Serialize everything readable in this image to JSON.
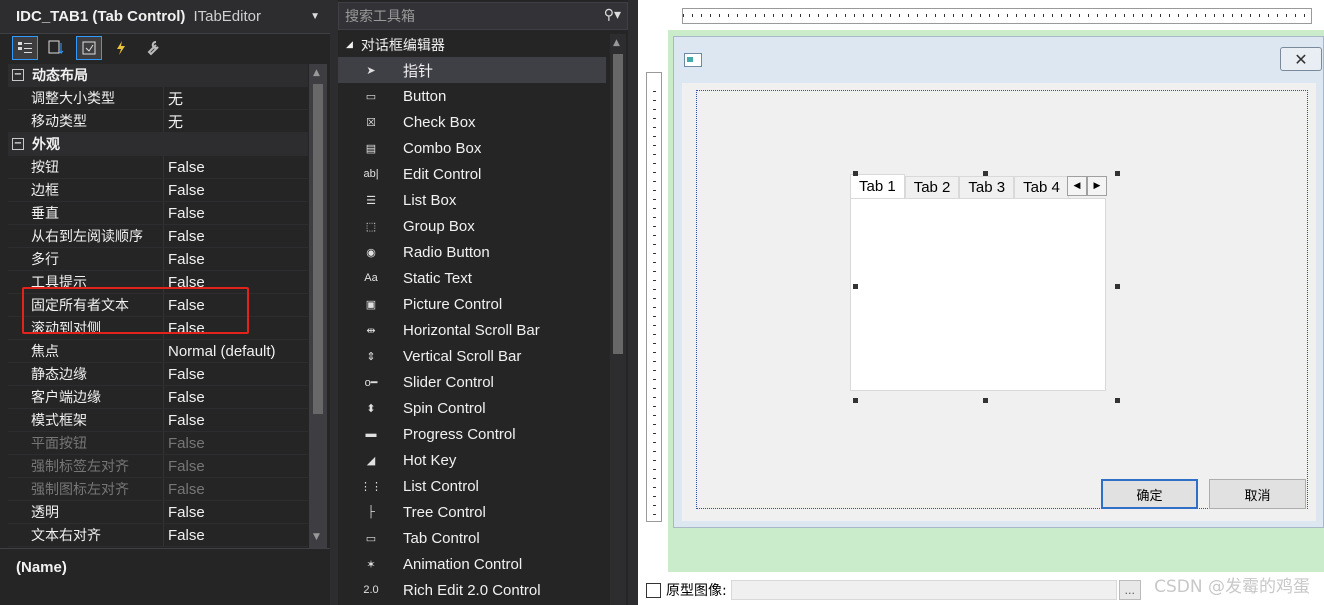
{
  "properties": {
    "object_name": "IDC_TAB1 (Tab Control)",
    "object_type": "ITabEditor",
    "categories": [
      {
        "name": "动态布局",
        "rows": [
          {
            "name": "调整大小类型",
            "value": "无",
            "disabled": false
          },
          {
            "name": "移动类型",
            "value": "无",
            "disabled": false
          }
        ]
      },
      {
        "name": "外观",
        "rows": [
          {
            "name": "按钮",
            "value": "False",
            "disabled": false
          },
          {
            "name": "边框",
            "value": "False",
            "disabled": false
          },
          {
            "name": "垂直",
            "value": "False",
            "disabled": false
          },
          {
            "name": "从右到左阅读顺序",
            "value": "False",
            "disabled": false
          },
          {
            "name": "多行",
            "value": "False",
            "disabled": false
          },
          {
            "name": "工具提示",
            "value": "False",
            "disabled": false
          },
          {
            "name": "固定所有者文本",
            "value": "False",
            "disabled": false
          },
          {
            "name": "滚动到对侧",
            "value": "False",
            "disabled": false
          },
          {
            "name": "焦点",
            "value": "Normal (default)",
            "disabled": false
          },
          {
            "name": "静态边缘",
            "value": "False",
            "disabled": false
          },
          {
            "name": "客户端边缘",
            "value": "False",
            "disabled": false
          },
          {
            "name": "模式框架",
            "value": "False",
            "disabled": false
          },
          {
            "name": "平面按钮",
            "value": "False",
            "disabled": true
          },
          {
            "name": "强制标签左对齐",
            "value": "False",
            "disabled": true
          },
          {
            "name": "强制图标左对齐",
            "value": "False",
            "disabled": true
          },
          {
            "name": "透明",
            "value": "False",
            "disabled": false
          },
          {
            "name": "文本右对齐",
            "value": "False",
            "disabled": false
          }
        ]
      }
    ],
    "description_title": "(Name)"
  },
  "toolbox": {
    "search_placeholder": "搜索工具箱",
    "group_title": "对话框编辑器",
    "items": [
      {
        "label": "指针",
        "icon": "pointer-icon",
        "glyph": "➤",
        "selected": true
      },
      {
        "label": "Button",
        "icon": "button-icon",
        "glyph": "▭",
        "selected": false
      },
      {
        "label": "Check Box",
        "icon": "checkbox-icon",
        "glyph": "☒",
        "selected": false
      },
      {
        "label": "Combo Box",
        "icon": "combobox-icon",
        "glyph": "▤",
        "selected": false
      },
      {
        "label": "Edit Control",
        "icon": "edit-control-icon",
        "glyph": "ab|",
        "selected": false
      },
      {
        "label": "List Box",
        "icon": "listbox-icon",
        "glyph": "☰",
        "selected": false
      },
      {
        "label": "Group Box",
        "icon": "groupbox-icon",
        "glyph": "⬚",
        "selected": false
      },
      {
        "label": "Radio Button",
        "icon": "radio-button-icon",
        "glyph": "◉",
        "selected": false
      },
      {
        "label": "Static Text",
        "icon": "static-text-icon",
        "glyph": "Aa",
        "selected": false
      },
      {
        "label": "Picture Control",
        "icon": "picture-control-icon",
        "glyph": "▣",
        "selected": false
      },
      {
        "label": "Horizontal Scroll Bar",
        "icon": "hscroll-icon",
        "glyph": "⇹",
        "selected": false
      },
      {
        "label": "Vertical Scroll Bar",
        "icon": "vscroll-icon",
        "glyph": "⇕",
        "selected": false
      },
      {
        "label": "Slider Control",
        "icon": "slider-icon",
        "glyph": "o━",
        "selected": false
      },
      {
        "label": "Spin Control",
        "icon": "spin-control-icon",
        "glyph": "⬍",
        "selected": false
      },
      {
        "label": "Progress Control",
        "icon": "progress-control-icon",
        "glyph": "▬",
        "selected": false
      },
      {
        "label": "Hot Key",
        "icon": "hotkey-icon",
        "glyph": "◢",
        "selected": false
      },
      {
        "label": "List Control",
        "icon": "list-control-icon",
        "glyph": "⋮⋮",
        "selected": false
      },
      {
        "label": "Tree Control",
        "icon": "tree-control-icon",
        "glyph": "├",
        "selected": false
      },
      {
        "label": "Tab Control",
        "icon": "tab-control-icon",
        "glyph": "▭",
        "selected": false
      },
      {
        "label": "Animation Control",
        "icon": "animation-control-icon",
        "glyph": "✶",
        "selected": false
      },
      {
        "label": "Rich Edit 2.0 Control",
        "icon": "rich-edit-icon",
        "glyph": "2.0",
        "selected": false
      }
    ]
  },
  "designer": {
    "dialog_close": "✕",
    "tabs": [
      "Tab 1",
      "Tab 2",
      "Tab 3",
      "Tab 4"
    ],
    "ok_label": "确定",
    "cancel_label": "取消",
    "prototype_label": "原型图像:",
    "browse_label": "..."
  },
  "watermark": "CSDN @发霉的鸡蛋"
}
